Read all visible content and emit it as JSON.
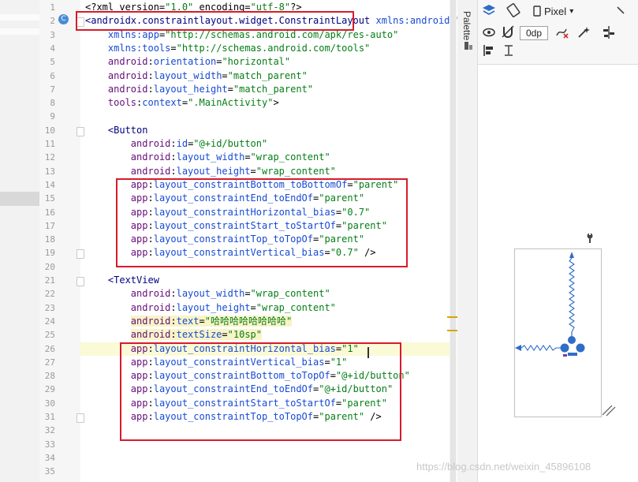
{
  "editor": {
    "lines": [
      {
        "n": "1",
        "html": [
          [
            "plain",
            "<?xml version="
          ],
          [
            "val",
            "\"1.0\""
          ],
          [
            "plain",
            " encoding="
          ],
          [
            "val",
            "\"utf-8\""
          ],
          [
            "plain",
            "?>"
          ]
        ]
      },
      {
        "n": "2",
        "html": [
          [
            "tag",
            "<androidx.constraintlayout.widget.ConstraintLayout"
          ],
          [
            "plain",
            " "
          ],
          [
            "attr",
            "xmlns:android"
          ],
          [
            "plain",
            "="
          ],
          [
            "val",
            "\"http"
          ]
        ]
      },
      {
        "n": "3",
        "html": [
          [
            "plain",
            "    "
          ],
          [
            "attr",
            "xmlns:app"
          ],
          [
            "plain",
            "="
          ],
          [
            "val",
            "\"http://schemas.android.com/apk/res-auto\""
          ]
        ]
      },
      {
        "n": "4",
        "html": [
          [
            "plain",
            "    "
          ],
          [
            "attr",
            "xmlns:tools"
          ],
          [
            "plain",
            "="
          ],
          [
            "val",
            "\"http://schemas.android.com/tools\""
          ]
        ]
      },
      {
        "n": "5",
        "html": [
          [
            "plain",
            "    "
          ],
          [
            "ns",
            "android"
          ],
          [
            "plain",
            ":"
          ],
          [
            "attr",
            "orientation"
          ],
          [
            "plain",
            "="
          ],
          [
            "val",
            "\"horizontal\""
          ]
        ]
      },
      {
        "n": "6",
        "html": [
          [
            "plain",
            "    "
          ],
          [
            "ns",
            "android"
          ],
          [
            "plain",
            ":"
          ],
          [
            "attr",
            "layout_width"
          ],
          [
            "plain",
            "="
          ],
          [
            "val",
            "\"match_parent\""
          ]
        ]
      },
      {
        "n": "7",
        "html": [
          [
            "plain",
            "    "
          ],
          [
            "ns",
            "android"
          ],
          [
            "plain",
            ":"
          ],
          [
            "attr",
            "layout_height"
          ],
          [
            "plain",
            "="
          ],
          [
            "val",
            "\"match_parent\""
          ]
        ]
      },
      {
        "n": "8",
        "html": [
          [
            "plain",
            "    "
          ],
          [
            "ns",
            "tools"
          ],
          [
            "plain",
            ":"
          ],
          [
            "attr",
            "context"
          ],
          [
            "plain",
            "="
          ],
          [
            "val",
            "\".MainActivity\""
          ],
          [
            "plain",
            ">"
          ]
        ]
      },
      {
        "n": "9",
        "html": []
      },
      {
        "n": "10",
        "html": [
          [
            "plain",
            "    "
          ],
          [
            "tag",
            "<Button"
          ]
        ]
      },
      {
        "n": "11",
        "html": [
          [
            "plain",
            "        "
          ],
          [
            "ns",
            "android"
          ],
          [
            "plain",
            ":"
          ],
          [
            "attr",
            "id"
          ],
          [
            "plain",
            "="
          ],
          [
            "val",
            "\"@+id/button\""
          ]
        ]
      },
      {
        "n": "12",
        "html": [
          [
            "plain",
            "        "
          ],
          [
            "ns",
            "android"
          ],
          [
            "plain",
            ":"
          ],
          [
            "attr",
            "layout_width"
          ],
          [
            "plain",
            "="
          ],
          [
            "val",
            "\"wrap_content\""
          ]
        ]
      },
      {
        "n": "13",
        "html": [
          [
            "plain",
            "        "
          ],
          [
            "ns",
            "android"
          ],
          [
            "plain",
            ":"
          ],
          [
            "attr",
            "layout_height"
          ],
          [
            "plain",
            "="
          ],
          [
            "val",
            "\"wrap_content\""
          ]
        ]
      },
      {
        "n": "14",
        "html": [
          [
            "plain",
            "        "
          ],
          [
            "ns",
            "app"
          ],
          [
            "plain",
            ":"
          ],
          [
            "attr",
            "layout_constraintBottom_toBottomOf"
          ],
          [
            "plain",
            "="
          ],
          [
            "val",
            "\"parent\""
          ]
        ]
      },
      {
        "n": "15",
        "html": [
          [
            "plain",
            "        "
          ],
          [
            "ns",
            "app"
          ],
          [
            "plain",
            ":"
          ],
          [
            "attr",
            "layout_constraintEnd_toEndOf"
          ],
          [
            "plain",
            "="
          ],
          [
            "val",
            "\"parent\""
          ]
        ]
      },
      {
        "n": "16",
        "html": [
          [
            "plain",
            "        "
          ],
          [
            "ns",
            "app"
          ],
          [
            "plain",
            ":"
          ],
          [
            "attr",
            "layout_constraintHorizontal_bias"
          ],
          [
            "plain",
            "="
          ],
          [
            "val",
            "\"0.7\""
          ]
        ]
      },
      {
        "n": "17",
        "html": [
          [
            "plain",
            "        "
          ],
          [
            "ns",
            "app"
          ],
          [
            "plain",
            ":"
          ],
          [
            "attr",
            "layout_constraintStart_toStartOf"
          ],
          [
            "plain",
            "="
          ],
          [
            "val",
            "\"parent\""
          ]
        ]
      },
      {
        "n": "18",
        "html": [
          [
            "plain",
            "        "
          ],
          [
            "ns",
            "app"
          ],
          [
            "plain",
            ":"
          ],
          [
            "attr",
            "layout_constraintTop_toTopOf"
          ],
          [
            "plain",
            "="
          ],
          [
            "val",
            "\"parent\""
          ]
        ]
      },
      {
        "n": "19",
        "html": [
          [
            "plain",
            "        "
          ],
          [
            "ns",
            "app"
          ],
          [
            "plain",
            ":"
          ],
          [
            "attr",
            "layout_constraintVertical_bias"
          ],
          [
            "plain",
            "="
          ],
          [
            "val",
            "\"0.7\""
          ],
          [
            "plain",
            " />"
          ]
        ]
      },
      {
        "n": "20",
        "html": []
      },
      {
        "n": "21",
        "html": [
          [
            "plain",
            "    "
          ],
          [
            "tag",
            "<TextView"
          ]
        ]
      },
      {
        "n": "22",
        "html": [
          [
            "plain",
            "        "
          ],
          [
            "ns",
            "android"
          ],
          [
            "plain",
            ":"
          ],
          [
            "attr",
            "layout_width"
          ],
          [
            "plain",
            "="
          ],
          [
            "val",
            "\"wrap_content\""
          ]
        ]
      },
      {
        "n": "23",
        "html": [
          [
            "plain",
            "        "
          ],
          [
            "ns",
            "android"
          ],
          [
            "plain",
            ":"
          ],
          [
            "attr",
            "layout_height"
          ],
          [
            "plain",
            "="
          ],
          [
            "val",
            "\"wrap_content\""
          ]
        ]
      },
      {
        "n": "24",
        "html": [
          [
            "plain",
            "        "
          ],
          [
            "ns",
            "android"
          ],
          [
            "plain",
            ":"
          ],
          [
            "attr",
            "text"
          ],
          [
            "plain",
            "="
          ],
          [
            "val",
            "\"哈哈哈哈哈哈哈哈\""
          ]
        ]
      },
      {
        "n": "25",
        "html": [
          [
            "plain",
            "        "
          ],
          [
            "ns",
            "android"
          ],
          [
            "plain",
            ":"
          ],
          [
            "attr",
            "textSize"
          ],
          [
            "plain",
            "="
          ],
          [
            "val",
            "\"10sp\""
          ]
        ]
      },
      {
        "n": "26",
        "html": [
          [
            "plain",
            "        "
          ],
          [
            "ns",
            "app"
          ],
          [
            "plain",
            ":"
          ],
          [
            "attr",
            "layout_constraintHorizontal_bias"
          ],
          [
            "plain",
            "="
          ],
          [
            "val",
            "\"1\""
          ]
        ]
      },
      {
        "n": "27",
        "html": [
          [
            "plain",
            "        "
          ],
          [
            "ns",
            "app"
          ],
          [
            "plain",
            ":"
          ],
          [
            "attr",
            "layout_constraintVertical_bias"
          ],
          [
            "plain",
            "="
          ],
          [
            "val",
            "\"1\""
          ]
        ]
      },
      {
        "n": "28",
        "html": [
          [
            "plain",
            "        "
          ],
          [
            "ns",
            "app"
          ],
          [
            "plain",
            ":"
          ],
          [
            "attr",
            "layout_constraintBottom_toTopOf"
          ],
          [
            "plain",
            "="
          ],
          [
            "val",
            "\"@+id/button\""
          ]
        ]
      },
      {
        "n": "29",
        "html": [
          [
            "plain",
            "        "
          ],
          [
            "ns",
            "app"
          ],
          [
            "plain",
            ":"
          ],
          [
            "attr",
            "layout_constraintEnd_toEndOf"
          ],
          [
            "plain",
            "="
          ],
          [
            "val",
            "\"@+id/button\""
          ]
        ]
      },
      {
        "n": "30",
        "html": [
          [
            "plain",
            "        "
          ],
          [
            "ns",
            "app"
          ],
          [
            "plain",
            ":"
          ],
          [
            "attr",
            "layout_constraintStart_toStartOf"
          ],
          [
            "plain",
            "="
          ],
          [
            "val",
            "\"parent\""
          ]
        ]
      },
      {
        "n": "31",
        "html": [
          [
            "plain",
            "        "
          ],
          [
            "ns",
            "app"
          ],
          [
            "plain",
            ":"
          ],
          [
            "attr",
            "layout_constraintTop_toTopOf"
          ],
          [
            "plain",
            "="
          ],
          [
            "val",
            "\"parent\""
          ],
          [
            "plain",
            " />"
          ]
        ]
      },
      {
        "n": "32",
        "html": []
      },
      {
        "n": "33",
        "html": []
      },
      {
        "n": "34",
        "html": []
      },
      {
        "n": "35",
        "html": []
      }
    ],
    "badge": "C"
  },
  "right_panel": {
    "palette_label": "Palette",
    "device_label": "Pixel",
    "margin_value": "0dp"
  },
  "watermark": "https://blog.csdn.net/weixin_45896108",
  "icons": [
    "layers-icon",
    "orientation-icon",
    "phone-icon",
    "eye-icon",
    "magnet-icon",
    "clear-constraints-icon",
    "infer-constraints-icon",
    "guidelines-icon",
    "align-icon",
    "baseline-icon",
    "wrench-icon",
    "resize-icon"
  ]
}
